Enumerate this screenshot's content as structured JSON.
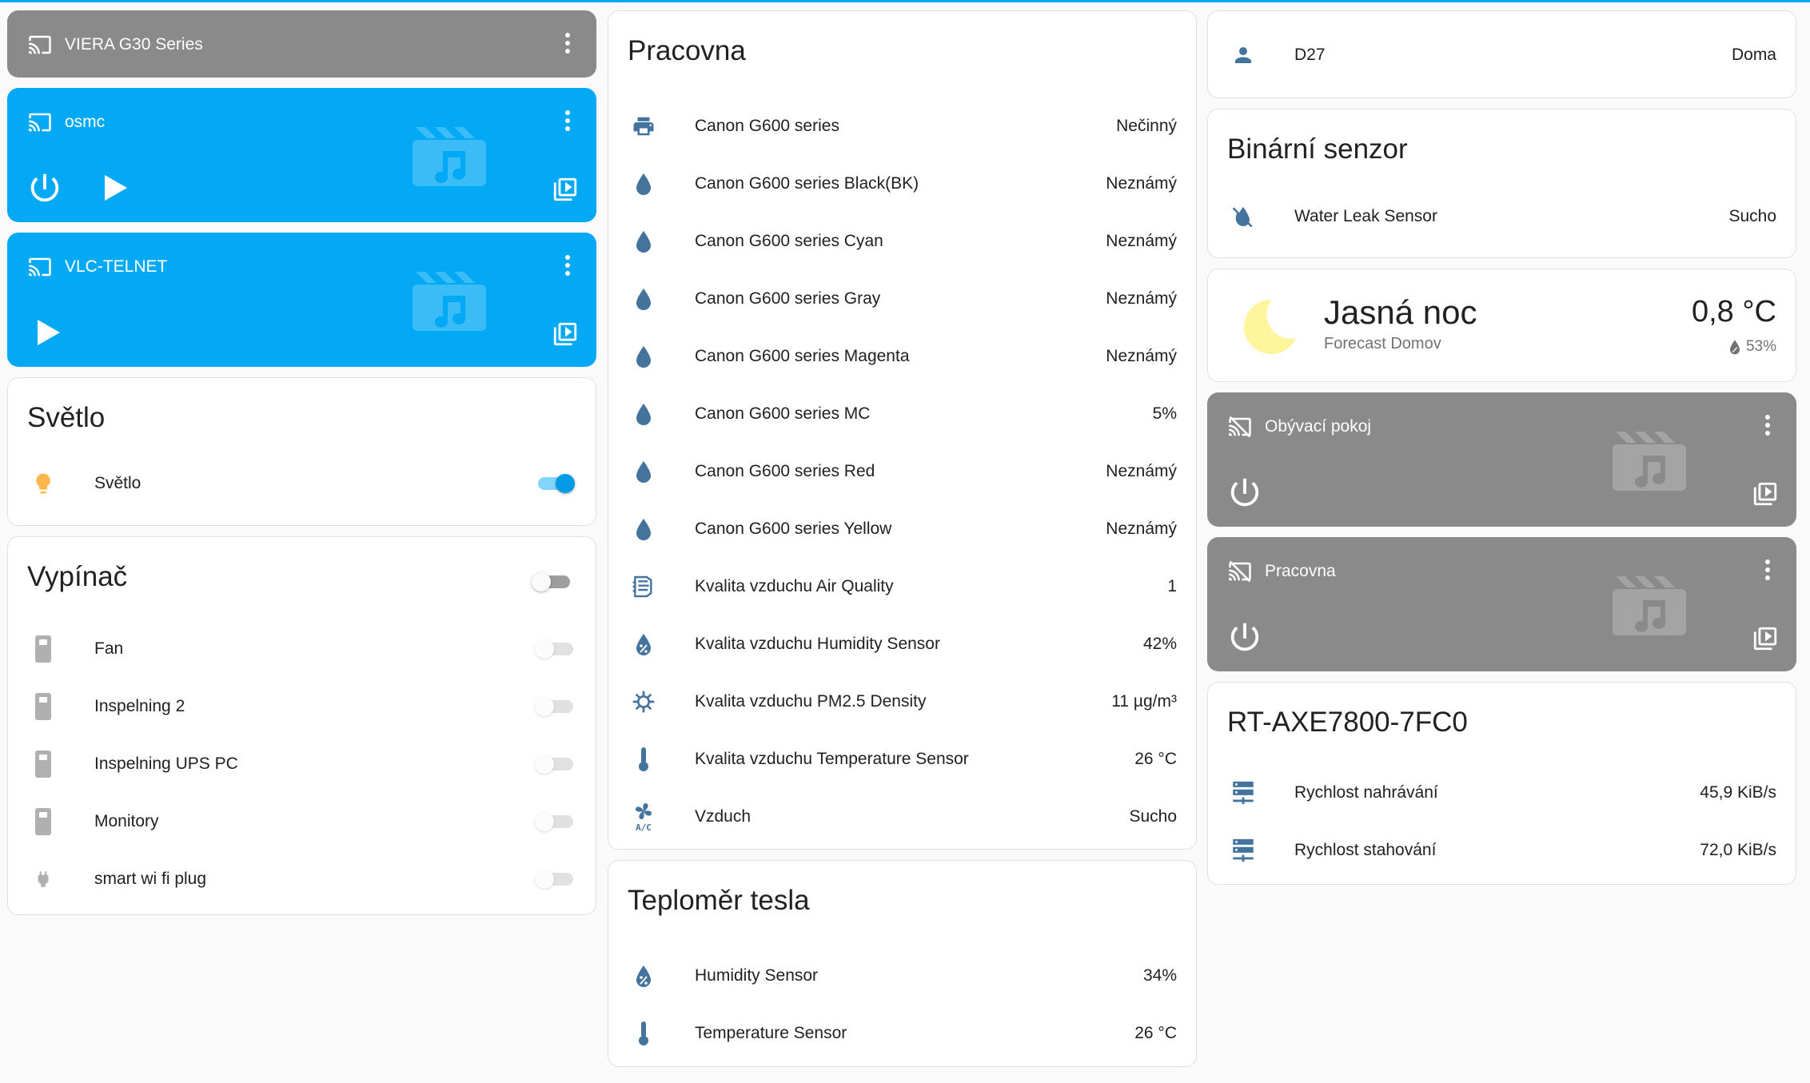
{
  "colors": {
    "accent": "#03a9f4",
    "icon_blue": "#44739e",
    "media_gray": "#8a8a8a",
    "bulb": "#ffb74d",
    "moon": "#fff59d"
  },
  "media_players": {
    "viera": {
      "title": "VIERA G30 Series"
    },
    "osmc": {
      "title": "osmc"
    },
    "vlc": {
      "title": "VLC-TELNET"
    },
    "obyvaci": {
      "title": "Obývací pokoj"
    },
    "pracovna": {
      "title": "Pracovna"
    }
  },
  "svetlo": {
    "title": "Světlo",
    "rows": [
      {
        "name": "Světlo",
        "icon": "bulb-icon",
        "state": "on"
      }
    ]
  },
  "vypinac": {
    "title": "Vypínač",
    "header_toggle": "off",
    "rows": [
      {
        "name": "Fan",
        "icon": "light-switch-icon"
      },
      {
        "name": "Inspelning 2",
        "icon": "light-switch-icon"
      },
      {
        "name": "Inspelning UPS PC",
        "icon": "light-switch-icon"
      },
      {
        "name": "Monitory",
        "icon": "light-switch-icon"
      },
      {
        "name": "smart wi fi plug",
        "icon": "power-plug-icon"
      }
    ]
  },
  "pracovna_card": {
    "title": "Pracovna",
    "rows": [
      {
        "name": "Canon G600 series",
        "value": "Nečinný",
        "icon": "printer-icon"
      },
      {
        "name": "Canon G600 series Black(BK)",
        "value": "Neznámý",
        "icon": "water-drop-icon"
      },
      {
        "name": "Canon G600 series Cyan",
        "value": "Neznámý",
        "icon": "water-drop-icon"
      },
      {
        "name": "Canon G600 series Gray",
        "value": "Neznámý",
        "icon": "water-drop-icon"
      },
      {
        "name": "Canon G600 series Magenta",
        "value": "Neznámý",
        "icon": "water-drop-icon"
      },
      {
        "name": "Canon G600 series MC",
        "value": "5%",
        "icon": "water-drop-icon"
      },
      {
        "name": "Canon G600 series Red",
        "value": "Neznámý",
        "icon": "water-drop-icon"
      },
      {
        "name": "Canon G600 series Yellow",
        "value": "Neznámý",
        "icon": "water-drop-icon"
      },
      {
        "name": "Kvalita vzduchu Air Quality",
        "value": "1",
        "icon": "air-filter-icon"
      },
      {
        "name": "Kvalita vzduchu Humidity Sensor",
        "value": "42%",
        "icon": "water-percent-icon"
      },
      {
        "name": "Kvalita vzduchu PM2.5 Density",
        "value": "11 µg/m³",
        "icon": "virus-icon"
      },
      {
        "name": "Kvalita vzduchu Temperature Sensor",
        "value": "26 °C",
        "icon": "thermometer-icon"
      },
      {
        "name": "Vzduch",
        "value": "Sucho",
        "icon": "air-conditioner-icon"
      }
    ]
  },
  "teplomer": {
    "title": "Teploměr tesla",
    "rows": [
      {
        "name": "Humidity Sensor",
        "value": "34%",
        "icon": "water-percent-icon"
      },
      {
        "name": "Temperature Sensor",
        "value": "26 °C",
        "icon": "thermometer-icon"
      }
    ]
  },
  "person": {
    "name": "D27",
    "value": "Doma",
    "icon": "account-icon"
  },
  "binary": {
    "title": "Binární senzor",
    "rows": [
      {
        "name": "Water Leak Sensor",
        "value": "Sucho",
        "icon": "water-off-icon"
      }
    ]
  },
  "weather": {
    "condition": "Jasná noc",
    "subtitle": "Forecast Domov",
    "temperature": "0,8 °C",
    "humidity": "53%"
  },
  "router": {
    "title": "RT-AXE7800-7FC0",
    "rows": [
      {
        "name": "Rychlost nahrávání",
        "value": "45,9 KiB/s",
        "icon": "server-network-icon"
      },
      {
        "name": "Rychlost stahování",
        "value": "72,0 KiB/s",
        "icon": "server-network-icon"
      }
    ]
  }
}
